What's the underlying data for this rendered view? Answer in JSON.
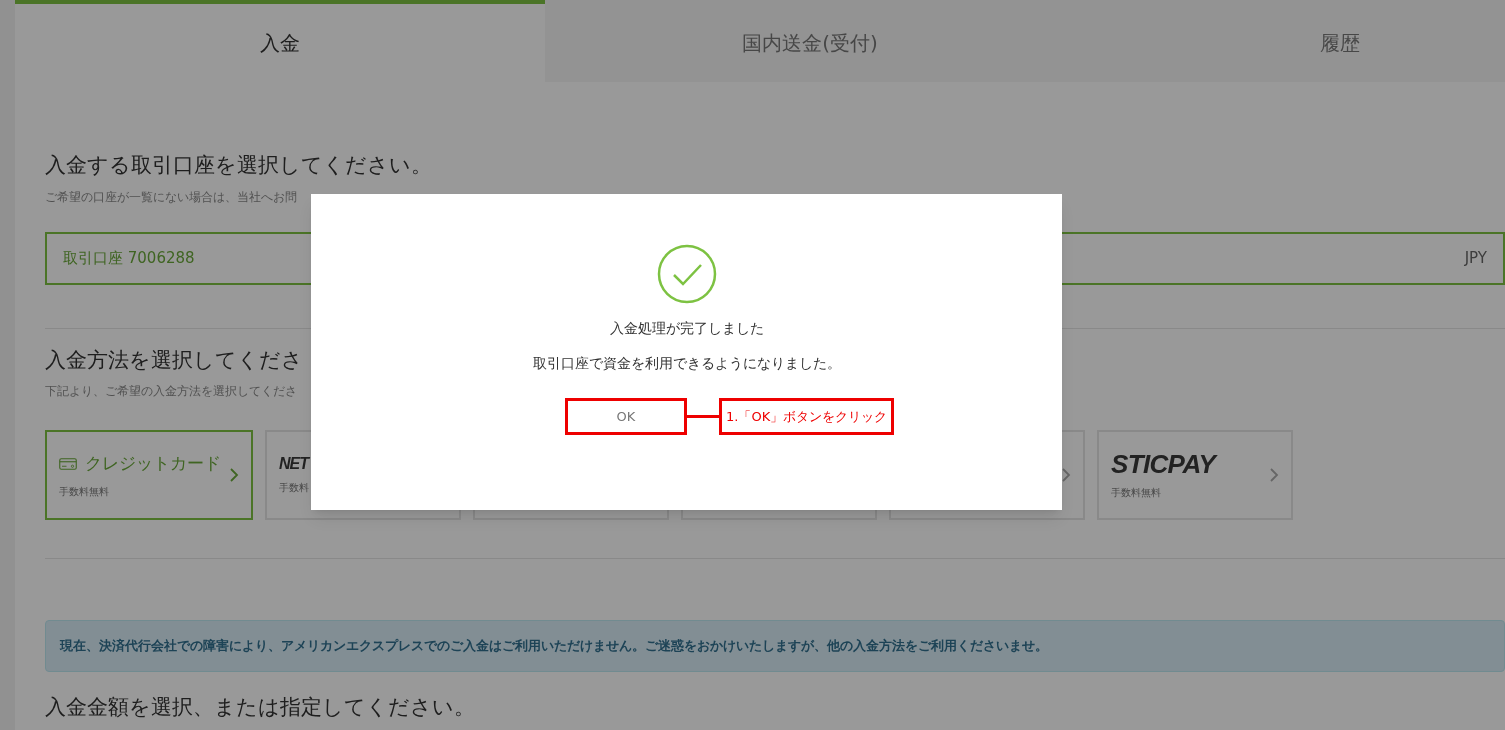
{
  "tabs": [
    {
      "label": "入金",
      "selected": true
    },
    {
      "label": "国内送金(受付)",
      "selected": false
    },
    {
      "label": "履歴",
      "selected": false
    }
  ],
  "account_section": {
    "heading": "入金する取引口座を選択してください。",
    "note": "ご希望の口座が一覧にない場合は、当社へお問",
    "account": {
      "value": "取引口座 7006288",
      "currency": "JPY"
    }
  },
  "method_section": {
    "heading": "入金方法を選択してくださ",
    "note": "下記より、ご希望の入金方法を選択してくださ",
    "methods": [
      {
        "kind": "card",
        "label": "クレジットカード",
        "fee": "手数料無料",
        "selected": true,
        "chevron": true
      },
      {
        "kind": "logo",
        "label": "NET",
        "fee": "手数料",
        "selected": false
      },
      {
        "kind": "covered",
        "selected": false
      },
      {
        "kind": "covered",
        "selected": false
      },
      {
        "kind": "covered",
        "selected": false,
        "chevron": true
      },
      {
        "kind": "logo",
        "label": "STICPAY",
        "fee": "手数料無料",
        "selected": false,
        "chevron": true
      }
    ]
  },
  "notice": "現在、決済代行会社での障害により、アメリカンエクスプレスでのご入金はご利用いただけません。ご迷惑をおかけいたしますが、他の入金方法をご利用くださいませ。",
  "amount_heading": "入金金額を選択、または指定してください。",
  "dialog": {
    "message": "入金処理が完了しました",
    "detail": "取引口座で資金を利用できるようになりました。",
    "button": "OK"
  },
  "annotation": "1.「OK」ボタンをクリック"
}
